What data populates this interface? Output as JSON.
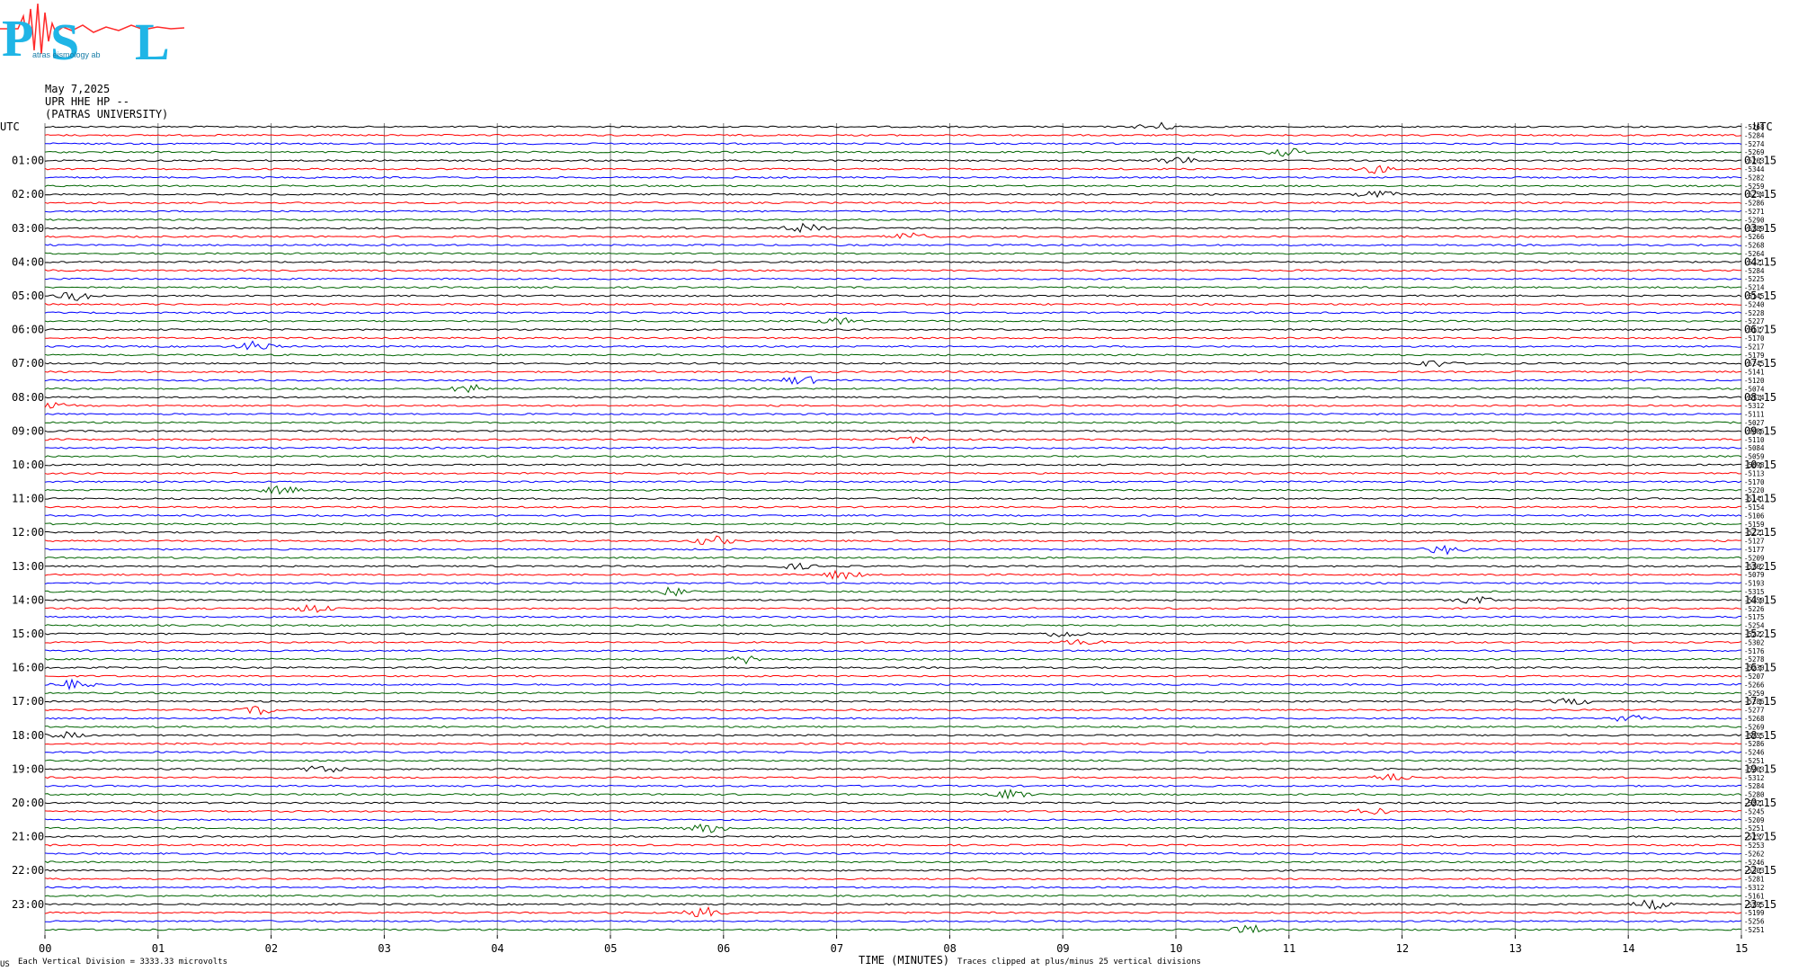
{
  "header": {
    "logo_text": "PSL",
    "logo_subtitle": "atras   eismology   ab",
    "date": "May 7,2025",
    "station": "UPR HHE HP --",
    "institution": "(PATRAS UNIVERSITY)"
  },
  "axis": {
    "utc_label": "UTC",
    "left_hour_labels": [
      "01:00",
      "02:00",
      "03:00",
      "04:00",
      "05:00",
      "06:00",
      "07:00",
      "08:00",
      "09:00",
      "10:00",
      "11:00",
      "12:00",
      "13:00",
      "14:00",
      "15:00",
      "16:00",
      "17:00",
      "18:00",
      "19:00",
      "20:00",
      "21:00",
      "22:00",
      "23:00"
    ],
    "right_hour_labels": [
      "01:15",
      "02:15",
      "03:15",
      "04:15",
      "05:15",
      "06:15",
      "07:15",
      "08:15",
      "09:15",
      "10:15",
      "11:15",
      "12:15",
      "13:15",
      "14:15",
      "15:15",
      "16:15",
      "17:15",
      "18:15",
      "19:15",
      "20:15",
      "21:15",
      "22:15",
      "23:15"
    ],
    "x_ticks": [
      "00",
      "01",
      "02",
      "03",
      "04",
      "05",
      "06",
      "07",
      "08",
      "09",
      "10",
      "11",
      "12",
      "13",
      "14",
      "15"
    ],
    "xlabel": "TIME (MINUTES)"
  },
  "footer": {
    "left_mark": "US",
    "scale_note": "Each Vertical Division = 3333.33 microvolts",
    "clip_note": "Traces clipped at plus/minus 25 vertical divisions"
  },
  "chart_data": {
    "type": "line",
    "title": "",
    "xlabel": "TIME (MINUTES)",
    "ylabel": "UTC",
    "xlim": [
      0,
      15
    ],
    "trace_count": 96,
    "minutes_per_trace": 15,
    "color_cycle": [
      "#000000",
      "#ff0000",
      "#0000ff",
      "#006400"
    ],
    "trace_offsets": [
      "-5268",
      "-5284",
      "-5274",
      "-5269",
      "-5263",
      "-5344",
      "-5282",
      "-5259",
      "-5254",
      "-5286",
      "-5271",
      "-5290",
      "-5289",
      "-5266",
      "-5268",
      "-5264",
      "-5221",
      "-5284",
      "-5225",
      "-5214",
      "-5145",
      "-5240",
      "-5228",
      "-5227",
      "-5117",
      "-5170",
      "-5217",
      "-5179",
      "-5245",
      "-5141",
      "-5120",
      "-5074",
      "-5114",
      "-5312",
      "-5111",
      "-5027",
      "-5086",
      "-5110",
      "-5084",
      "-5059",
      "-5098",
      "-5113",
      "-5170",
      "-5220",
      "-5141",
      "-5154",
      "-5106",
      "-5159",
      "-5221",
      "-5127",
      "-5177",
      "-5209",
      "-5262",
      "-5079",
      "-5193",
      "-5315",
      "-5350",
      "-5226",
      "-5175",
      "-5254",
      "-5222",
      "-5302",
      "-5176",
      "-5278",
      "-5230",
      "-5207",
      "-5266",
      "-5259",
      "-5286",
      "-5277",
      "-5268",
      "-5269",
      "-5255",
      "-5286",
      "-5246",
      "-5251",
      "-5263",
      "-5312",
      "-5284",
      "-5280",
      "-5221",
      "-5245",
      "-5209",
      "-5251",
      "-5257",
      "-5253",
      "-5262",
      "-5246",
      "-5303",
      "-5281",
      "-5312",
      "-5161",
      "-5295",
      "-5199",
      "-5256",
      "-5251"
    ],
    "grid": "vertical minute lines"
  }
}
